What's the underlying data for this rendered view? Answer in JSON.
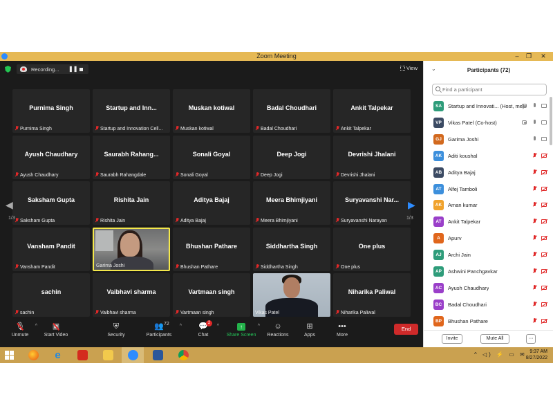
{
  "window": {
    "title": "Zoom Meeting",
    "minimize": "–",
    "restore": "❐",
    "close": "✕"
  },
  "topbar": {
    "recording_label": "Recording...",
    "pause_glyph": "❚❚",
    "view_label": "View"
  },
  "gallery": {
    "page_indicator": "1/3",
    "tiles": [
      {
        "big": "Purnima Singh",
        "name": "Purnima Singh"
      },
      {
        "big": "Startup  and  Inn...",
        "name": "Startup and Innovation Cell..."
      },
      {
        "big": "Muskan kotiwal",
        "name": "Muskan kotiwal"
      },
      {
        "big": "Badal Choudhari",
        "name": "Badal Choudhari"
      },
      {
        "big": "Ankit Talpekar",
        "name": "Ankit Talpekar"
      },
      {
        "big": "Ayush Chaudhary",
        "name": "Ayush Chaudhary"
      },
      {
        "big": "Saurabh  Rahang...",
        "name": "Saurabh Rahangdale"
      },
      {
        "big": "Sonali Goyal",
        "name": "Sonali Goyal"
      },
      {
        "big": "Deep Jogi",
        "name": "Deep Jogi"
      },
      {
        "big": "Devrishi Jhalani",
        "name": "Devrishi Jhalani"
      },
      {
        "big": "Saksham Gupta",
        "name": "Saksham Gupta"
      },
      {
        "big": "Rishita Jain",
        "name": "Rishita Jain"
      },
      {
        "big": "Aditya Bajaj",
        "name": "Aditya Bajaj"
      },
      {
        "big": "Meera Bhimjiyani",
        "name": "Meera Bhimjiyani"
      },
      {
        "big": "Suryavanshi  Nar...",
        "name": "Suryavanshi Narayan"
      },
      {
        "big": "Vansham Pandit",
        "name": "Vansham Pandit"
      },
      {
        "big": "",
        "name": "Garima Joshi"
      },
      {
        "big": "Bhushan Pathare",
        "name": "Bhushan Pathare"
      },
      {
        "big": "Siddhartha Singh",
        "name": "Siddhartha Singh"
      },
      {
        "big": "One plus",
        "name": "One plus"
      },
      {
        "big": "sachin",
        "name": "sachin"
      },
      {
        "big": "Vaibhavi sharma",
        "name": "Vaibhavi sharma"
      },
      {
        "big": "Vartmaan singh",
        "name": "Vartmaan singh"
      },
      {
        "big": "",
        "name": "Vikas Patel"
      },
      {
        "big": "Niharika Paliwal",
        "name": "Niharika Paliwal"
      }
    ]
  },
  "toolbar": {
    "unmute": "Unmute",
    "start_video": "Start Video",
    "security": "Security",
    "participants": "Participants",
    "participants_count": "72",
    "chat": "Chat",
    "chat_badge": "2",
    "share_screen": "Share Screen",
    "reactions": "Reactions",
    "apps": "Apps",
    "more": "More",
    "more_glyph": "•••",
    "end": "End"
  },
  "panel": {
    "title": "Participants (72)",
    "search_placeholder": "Find a participant",
    "invite": "Invite",
    "mute_all": "Mute All",
    "more_glyph": "···",
    "participants": [
      {
        "initials": "SA",
        "name": "Startup and Innovati... (Host, me)",
        "color": "#2e9c7a"
      },
      {
        "initials": "VP",
        "name": "Vikas Patel (Co-host)",
        "color": "#3b4a63"
      },
      {
        "initials": "GJ",
        "name": "Garima Joshi",
        "color": "#d2691e"
      },
      {
        "initials": "AK",
        "name": "Aditi koushal",
        "color": "#3c8fdc"
      },
      {
        "initials": "AB",
        "name": "Aditya Bajaj",
        "color": "#3b4a63"
      },
      {
        "initials": "AT",
        "name": "Alfej Tamboli",
        "color": "#3c8fdc"
      },
      {
        "initials": "AK",
        "name": "Aman kumar",
        "color": "#f0a22c"
      },
      {
        "initials": "AT",
        "name": "Ankit Talpekar",
        "color": "#9a3fc9"
      },
      {
        "initials": "A",
        "name": "Apurv",
        "color": "#e0661c"
      },
      {
        "initials": "AJ",
        "name": "Archi Jain",
        "color": "#2e9c7a"
      },
      {
        "initials": "AP",
        "name": "Ashwini Panchgavkar",
        "color": "#2e9c7a"
      },
      {
        "initials": "AC",
        "name": "Ayush Chaudhary",
        "color": "#9a3fc9"
      },
      {
        "initials": "BC",
        "name": "Badal Choudhari",
        "color": "#9a3fc9"
      },
      {
        "initials": "BP",
        "name": "Bhushan Pathare",
        "color": "#e0661c"
      }
    ]
  },
  "taskbar": {
    "time": "9:37 AM",
    "date": "8/27/2022",
    "tray_glyphs": "^ ◁) ⚡ ▭ ✉"
  }
}
